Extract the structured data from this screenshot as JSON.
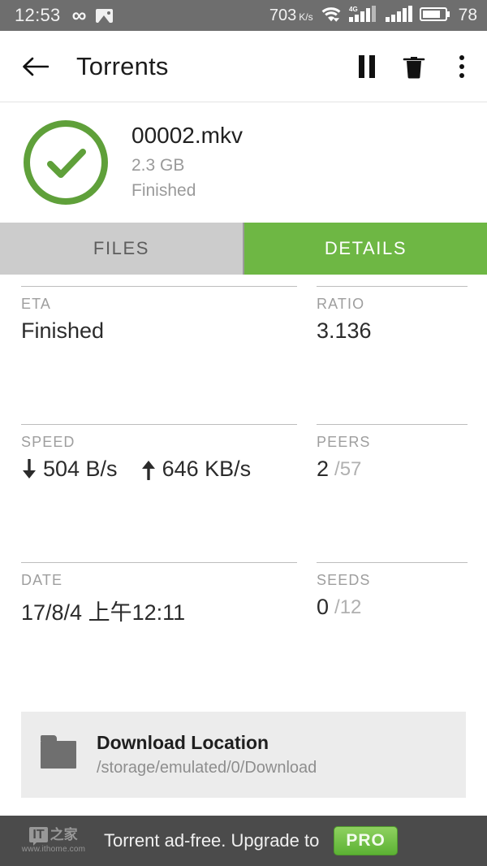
{
  "statusbar": {
    "time": "12:53",
    "icons": [
      "infinity-icon",
      "photo-icon"
    ],
    "net_speed": "703",
    "net_speed_unit": "K/s",
    "wifi_icon": "wifi-icon",
    "mobile_network": "4G",
    "battery_level": "78"
  },
  "appbar": {
    "back_icon": "back-arrow-icon",
    "title": "Torrents",
    "pause_icon": "pause-icon",
    "delete_icon": "trash-icon",
    "overflow_icon": "more-vertical-icon"
  },
  "summary": {
    "progress_percent": 100,
    "status_icon": "check-circle-icon",
    "name": "00002.mkv",
    "size": "2.3 GB",
    "state": "Finished",
    "accent_color": "#6eb744"
  },
  "tabs": [
    {
      "label": "FILES",
      "active": false
    },
    {
      "label": "DETAILS",
      "active": true
    }
  ],
  "details": [
    {
      "left": {
        "label": "ETA",
        "value": "Finished"
      },
      "right": {
        "label": "RATIO",
        "value": "3.136"
      }
    },
    {
      "left": {
        "label": "SPEED",
        "download_arrow": "arrow-down-icon",
        "download": "504 B/s",
        "upload_arrow": "arrow-up-icon",
        "upload": "646 KB/s"
      },
      "right": {
        "label": "PEERS",
        "value": "2",
        "total": "/57"
      }
    },
    {
      "left": {
        "label": "DATE",
        "value": "17/8/4 上午12:11"
      },
      "right": {
        "label": "SEEDS",
        "value": "0",
        "total": "/12"
      }
    }
  ],
  "download_location": {
    "icon": "folder-icon",
    "title": "Download Location",
    "path": "/storage/emulated/0/Download"
  },
  "footer": {
    "watermark_it": "IT",
    "watermark_cn": "之家",
    "watermark_url": "www.ithome.com",
    "ad_text": "Torrent ad-free. Upgrade to",
    "pro_label": "PRO"
  }
}
